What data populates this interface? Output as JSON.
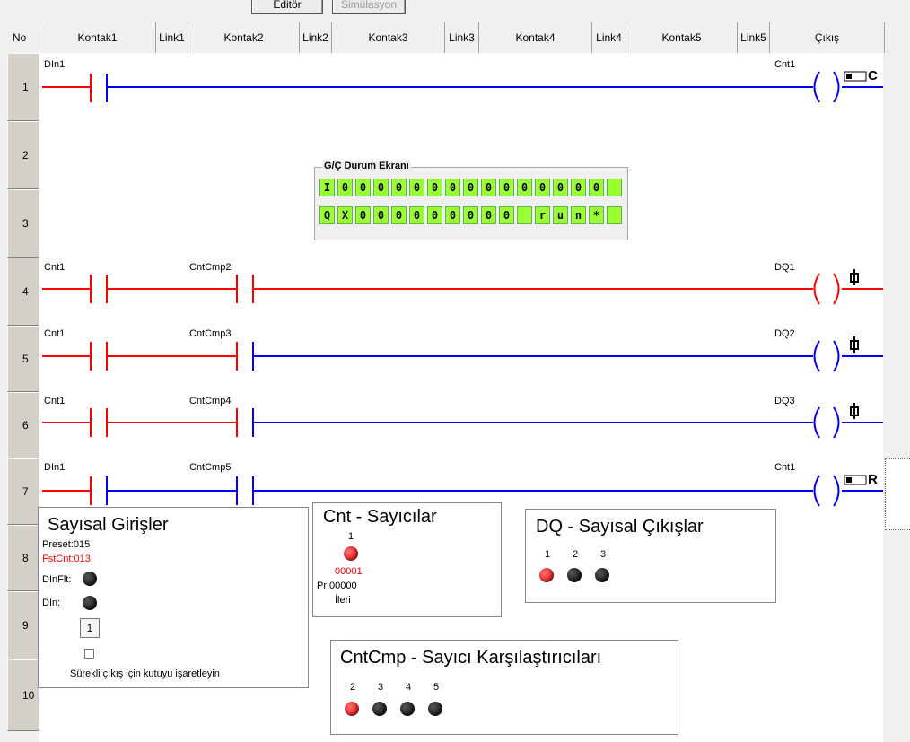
{
  "toolbar": {
    "editor": "Editör",
    "simulation": "Simülasyon"
  },
  "header": {
    "no": "No",
    "kontak1": "Kontak1",
    "link1": "Link1",
    "kontak2": "Kontak2",
    "link2": "Link2",
    "kontak3": "Kontak3",
    "link3": "Link3",
    "kontak4": "Kontak4",
    "link4": "Link4",
    "kontak5": "Kontak5",
    "link5": "Link5",
    "output": "Çıkış"
  },
  "rows": [
    "1",
    "2",
    "3",
    "4",
    "5",
    "6",
    "7",
    "8",
    "9",
    "10"
  ],
  "rungs": {
    "r1": {
      "c1": "DIn1",
      "out": "Cnt1",
      "sym": "C"
    },
    "r4": {
      "c1": "Cnt1",
      "c2": "CntCmp2",
      "out": "DQ1"
    },
    "r5": {
      "c1": "Cnt1",
      "c2": "CntCmp3",
      "out": "DQ2"
    },
    "r6": {
      "c1": "Cnt1",
      "c2": "CntCmp4",
      "out": "DQ3"
    },
    "r7": {
      "c1": "DIn1",
      "c2": "CntCmp5",
      "out": "Cnt1",
      "sym": "R"
    }
  },
  "io_status": {
    "title": "G/Ç Durum Ekranı",
    "row1": [
      "I",
      "0",
      "0",
      "0",
      "0",
      "0",
      "0",
      "0",
      "0",
      "0",
      "0",
      "0",
      "0",
      "0",
      "0",
      "0",
      ""
    ],
    "row2": [
      "Q",
      "X",
      "0",
      "0",
      "0",
      "0",
      "0",
      "0",
      "0",
      "0",
      "0",
      "",
      "r",
      "u",
      "n",
      "*",
      ""
    ]
  },
  "digital_inputs": {
    "title": "Sayısal Girişler",
    "preset": "Preset:015",
    "fst_label": "FstCnt:",
    "fst_value": "013",
    "dinflt": "DInFlt:",
    "din": "DIn:",
    "button": "1",
    "hint": "Sürekli çıkış için kutuyu işaretleyin"
  },
  "counters": {
    "title": "Cnt - Sayıcılar",
    "index": "1",
    "value": "00001",
    "preset": "Pr:00000",
    "direction": "İleri"
  },
  "digital_outputs": {
    "title": "DQ - Sayısal Çıkışlar",
    "labels": [
      "1",
      "2",
      "3"
    ]
  },
  "comparators": {
    "title": "CntCmp - Sayıcı Karşılaştırıcıları",
    "labels": [
      "2",
      "3",
      "4",
      "5"
    ]
  },
  "colors": {
    "energized": "#ff0000",
    "deenergized": "#0000ff",
    "lcd": "#99ff33"
  }
}
